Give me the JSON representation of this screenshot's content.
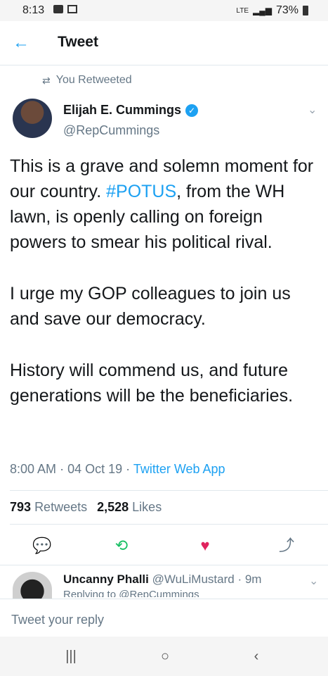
{
  "status": {
    "time": "8:13",
    "network": "LTE",
    "battery": "73%"
  },
  "header": {
    "title": "Tweet"
  },
  "retweet_note": "You Retweeted",
  "author": {
    "name": "Elijah E. Cummings",
    "handle": "@RepCummings"
  },
  "tweet": {
    "line1_pre": "This is a grave and solemn moment for our country. ",
    "hashtag": "#POTUS",
    "line1_post": ", from the WH lawn, is openly calling on foreign powers to smear his political rival.",
    "para2": "I urge my GOP colleagues to join us and save our democracy.",
    "para3": "History will commend us, and future generations will be the beneficiaries."
  },
  "meta": {
    "time": "8:00 AM",
    "date": "04 Oct 19",
    "app": "Twitter Web App",
    "sep": "·"
  },
  "stats": {
    "retweets_count": "793",
    "retweets_label": "Retweets",
    "likes_count": "2,528",
    "likes_label": "Likes"
  },
  "reply": {
    "name": "Uncanny Phalli",
    "handle": "@WuLiMustard",
    "age": "9m",
    "sub": "Replying to @RepCummings"
  },
  "composer": {
    "placeholder": "Tweet your reply"
  },
  "colors": {
    "accent": "#1da1f2",
    "like": "#e0245e",
    "retweet": "#17bf63"
  }
}
